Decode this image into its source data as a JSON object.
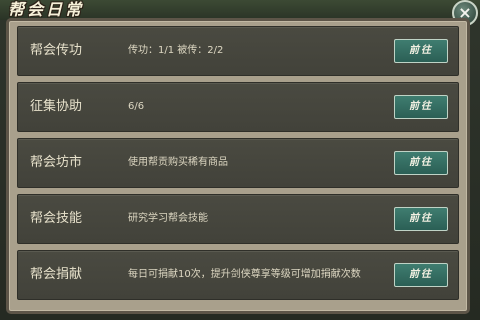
{
  "window": {
    "title": "帮会日常",
    "close_icon": "×"
  },
  "rows": [
    {
      "name": "帮会传功",
      "desc": "传功：1/1 被传：2/2",
      "button": "前往"
    },
    {
      "name": "征集协助",
      "desc": "6/6",
      "button": "前往"
    },
    {
      "name": "帮会坊市",
      "desc": "使用帮贡购买稀有商品",
      "button": "前往"
    },
    {
      "name": "帮会技能",
      "desc": "研究学习帮会技能",
      "button": "前往"
    },
    {
      "name": "帮会捐献",
      "desc": "每日可捐献10次，提升剑侠尊享等级可增加捐献次数",
      "button": "前往"
    }
  ]
}
